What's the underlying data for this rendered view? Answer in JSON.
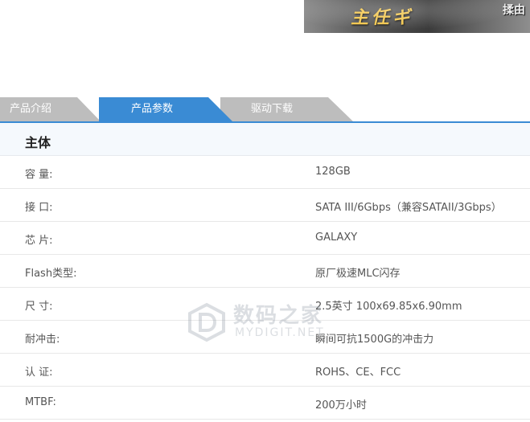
{
  "banner": {
    "text_left": "主任ギ",
    "text_right": "揉由"
  },
  "tabs": [
    {
      "label": "产品介绍",
      "active": false
    },
    {
      "label": "产品参数",
      "active": true
    },
    {
      "label": "驱动下载",
      "active": false
    }
  ],
  "spec": {
    "section_title": "主体",
    "rows": [
      {
        "label": "容 量:",
        "value": "128GB"
      },
      {
        "label": "接 口:",
        "value": "SATA III/6Gbps（兼容SATAII/3Gbps）"
      },
      {
        "label": "芯 片:",
        "value": "GALAXY"
      },
      {
        "label": "Flash类型:",
        "value": "原厂极速MLC闪存"
      },
      {
        "label": "尺 寸:",
        "value": "2.5英寸 100x69.85x6.90mm"
      },
      {
        "label": "耐冲击:",
        "value": "瞬间可抗1500G的冲击力"
      },
      {
        "label": "认 证:",
        "value": "ROHS、CE、FCC"
      },
      {
        "label": "MTBF:",
        "value": "200万小时"
      }
    ]
  },
  "watermark": {
    "cn": "数码之家",
    "en": "MYDIGIT.NET"
  },
  "colors": {
    "accent": "#3a8bd4",
    "tab_inactive": "#bdbdbd",
    "text": "#555555"
  }
}
